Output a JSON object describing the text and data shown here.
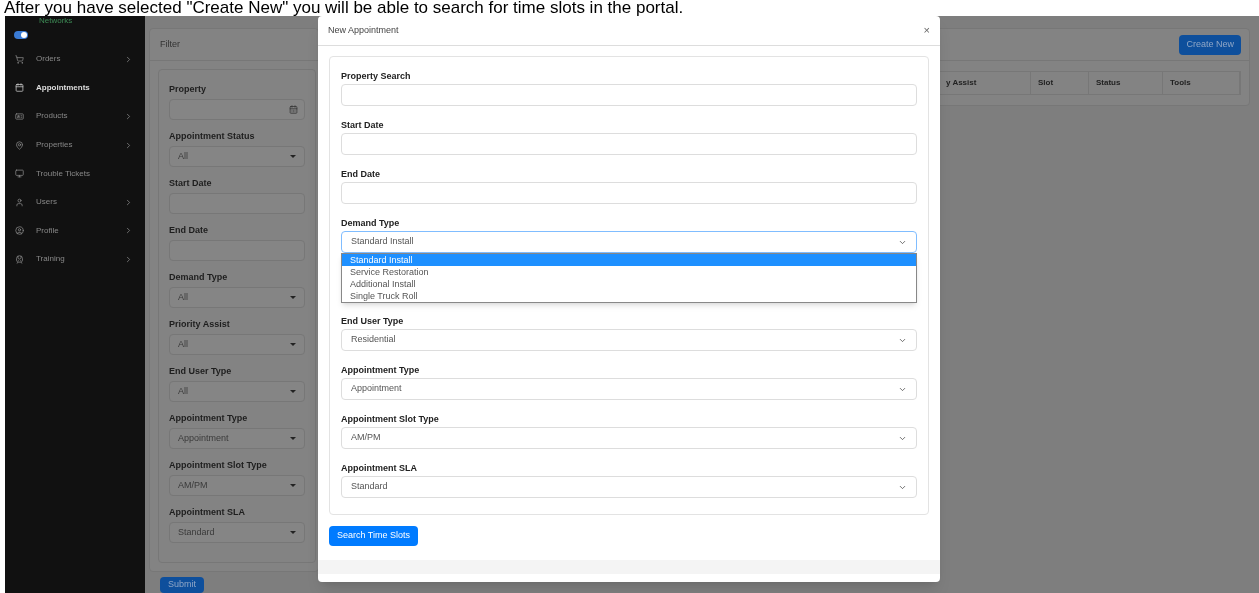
{
  "caption": "After you have selected \"Create New\" you will be able to search for time slots in the portal.",
  "sidebar": {
    "logo_text": "Networks",
    "toggle_on": true,
    "items": [
      {
        "label": "Orders",
        "selected": false,
        "has_children": true
      },
      {
        "label": "Appointments",
        "selected": true,
        "has_children": false
      },
      {
        "label": "Products",
        "selected": false,
        "has_children": true
      },
      {
        "label": "Properties",
        "selected": false,
        "has_children": true
      },
      {
        "label": "Trouble Tickets",
        "selected": false,
        "has_children": false
      },
      {
        "label": "Users",
        "selected": false,
        "has_children": true
      },
      {
        "label": "Profile",
        "selected": false,
        "has_children": true
      },
      {
        "label": "Training",
        "selected": false,
        "has_children": true
      }
    ]
  },
  "filter": {
    "title": "Filter",
    "fields": [
      {
        "label": "Property",
        "kind": "lookup"
      },
      {
        "label": "Appointment Status",
        "kind": "select",
        "value": "All"
      },
      {
        "label": "Start Date",
        "kind": "input"
      },
      {
        "label": "End Date",
        "kind": "input"
      },
      {
        "label": "Demand Type",
        "kind": "select",
        "value": "All"
      },
      {
        "label": "Priority Assist",
        "kind": "select",
        "value": "All"
      },
      {
        "label": "End User Type",
        "kind": "select",
        "value": "All"
      },
      {
        "label": "Appointment Type",
        "kind": "select",
        "value": "Appointment"
      },
      {
        "label": "Appointment Slot Type",
        "kind": "select",
        "value": "AM/PM"
      },
      {
        "label": "Appointment SLA",
        "kind": "select",
        "value": "Standard"
      }
    ],
    "submit": "Submit"
  },
  "list": {
    "create_button": "Create New",
    "columns": [
      "y Assist",
      "Slot",
      "Status",
      "Tools"
    ]
  },
  "modal": {
    "title": "New Appointment",
    "close": "×",
    "fields": [
      {
        "label": "Property Search",
        "kind": "input"
      },
      {
        "label": "Start Date",
        "kind": "input"
      },
      {
        "label": "End Date",
        "kind": "input"
      },
      {
        "label": "Demand Type",
        "kind": "select",
        "value": "Standard Install",
        "open": true,
        "options": [
          {
            "label": "Standard Install",
            "selected": true
          },
          {
            "label": "Service Restoration",
            "selected": false
          },
          {
            "label": "Additional Install",
            "selected": false
          },
          {
            "label": "Single Truck Roll",
            "selected": false
          }
        ]
      },
      {
        "label": "End User Type",
        "kind": "select",
        "value": "Residential",
        "open": false
      },
      {
        "label": "Appointment Type",
        "kind": "select",
        "value": "Appointment",
        "open": false
      },
      {
        "label": "Appointment Slot Type",
        "kind": "select",
        "value": "AM/PM",
        "open": false
      },
      {
        "label": "Appointment SLA",
        "kind": "select",
        "value": "Standard",
        "open": false
      }
    ],
    "search_button": "Search Time Slots"
  }
}
